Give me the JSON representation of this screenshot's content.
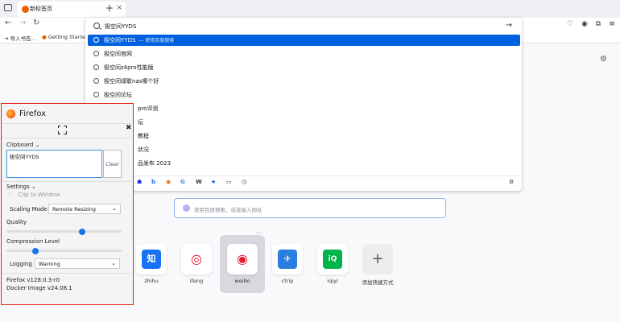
{
  "browser": {
    "tab_title": "新标签页",
    "tab_close": "×",
    "new_tab": "+",
    "bookmarks": [
      "导入书签…",
      "Getting Started"
    ]
  },
  "urlbar": {
    "value": "极空间YYDS",
    "suggestions": [
      {
        "text": "极空间YYDS",
        "hint": "— 使用百度搜索",
        "selected": true
      },
      {
        "text": "极空间官网",
        "hint": ""
      },
      {
        "text": "极空间z4pro性能版",
        "hint": ""
      },
      {
        "text": "极空间绿联nas哪个好",
        "hint": ""
      },
      {
        "text": "极空间论坛",
        "hint": ""
      },
      {
        "text": "pro评测",
        "hint": ""
      },
      {
        "text": "坛",
        "hint": ""
      },
      {
        "text": "教程",
        "hint": ""
      },
      {
        "text": "状况",
        "hint": ""
      },
      {
        "text": "品发布 2023",
        "hint": ""
      }
    ]
  },
  "search": {
    "placeholder": "使用百度搜索，或者输入网址"
  },
  "shortcuts": [
    {
      "name": "zhihu",
      "glyph": "知",
      "color": "#1772f6"
    },
    {
      "name": "ifeng",
      "glyph": "◎",
      "color": "#ffffff"
    },
    {
      "name": "weibo",
      "glyph": "◉",
      "color": "#ffffff"
    },
    {
      "name": "ctrip",
      "glyph": "✈",
      "color": "#2a7de1"
    },
    {
      "name": "iqiyi",
      "glyph": "iQ",
      "color": "#00b44b"
    },
    {
      "name": "添加快捷方式",
      "glyph": "+",
      "color": ""
    }
  ],
  "panel": {
    "title": "Firefox",
    "clipboard_label": "Clipboard ⌄",
    "clipboard_value": "极空间YYDS",
    "clear_label": "Clear",
    "settings_label": "Settings ⌄",
    "clip_to_window": "Clip to Window",
    "scaling_label": "Scaling Mode",
    "scaling_value": "Remote Resizing",
    "quality_label": "Quality",
    "quality_level": 0.67,
    "compression_label": "Compression Level",
    "compression_level": 0.24,
    "logging_label": "Logging",
    "logging_value": "Warning",
    "version": "Firefox v128.0.3-r0",
    "docker": "Docker Image v24.08.1"
  }
}
